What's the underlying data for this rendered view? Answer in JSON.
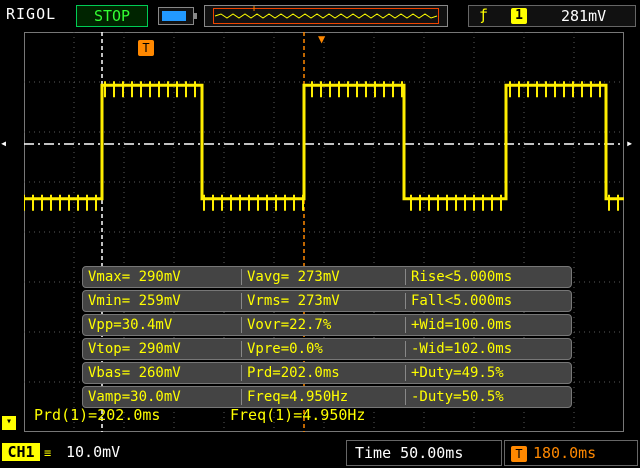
{
  "brand": "RIGOL",
  "run_state": "STOP",
  "trigger": {
    "slope_icon": "rising-edge-icon",
    "source": "1",
    "level": "281mV"
  },
  "memory_marker": "T",
  "trigger_marker": "T",
  "measurements": [
    [
      "Vmax= 290mV",
      "Vavg= 273mV",
      "Rise<5.000ms"
    ],
    [
      "Vmin= 259mV",
      "Vrms= 273mV",
      "Fall<5.000ms"
    ],
    [
      "Vpp=30.4mV",
      "Vovr=22.7%",
      "+Wid=100.0ms"
    ],
    [
      "Vtop= 290mV",
      "Vpre=0.0%",
      "-Wid=102.0ms"
    ],
    [
      "Vbas= 260mV",
      "Prd=202.0ms",
      "+Duty=49.5%"
    ],
    [
      "Vamp=30.0mV",
      "Freq=4.950Hz",
      "-Duty=50.5%"
    ]
  ],
  "bottom_measures": {
    "prd": "Prd(1)=202.0ms",
    "freq": "Freq(1)=4.950Hz"
  },
  "channel": {
    "label": "CH1",
    "coupling_icon": "dc-coupling-icon",
    "scale": "10.0mV"
  },
  "timebase": {
    "label": "Time",
    "value": "50.00ms"
  },
  "trigger_offset": {
    "icon": "T",
    "value": "180.0ms"
  },
  "colors": {
    "trace": "#ffee00",
    "trigger": "#ff8800",
    "stop": "#33ff33"
  },
  "waveform": {
    "type": "square",
    "high_level": 290,
    "low_level": 260,
    "period_ms": 202.0,
    "positive_width_ms": 100.0,
    "time_per_div_ms": 50.0,
    "mv_per_div": 10.0
  }
}
